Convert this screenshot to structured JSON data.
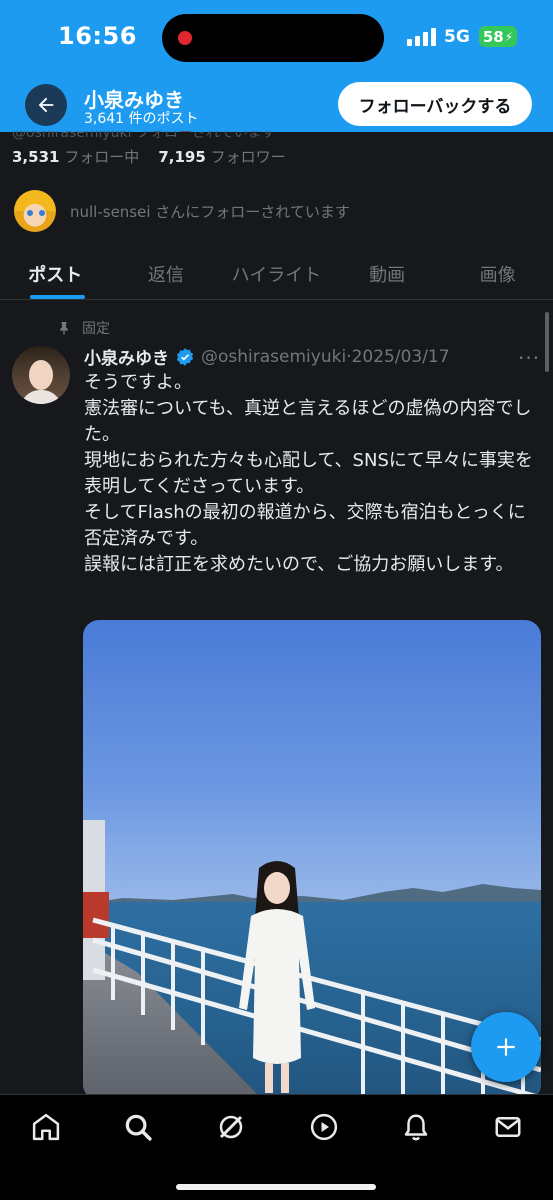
{
  "status_bar": {
    "time": "16:56",
    "network": "5G",
    "battery": "58"
  },
  "header": {
    "name": "小泉みゆき",
    "post_count": "3,641 件のポスト",
    "follow_back_label": "フォローバックする",
    "accent_color": "#1d9bf0"
  },
  "profile": {
    "faded_line": "@oshirasemiyuki  フォローされています",
    "following_count": "3,531",
    "following_label": "フォロー中",
    "followers_count": "7,195",
    "followers_label": "フォロワー",
    "followed_by_user": "null-sensei",
    "followed_by_suffix": " さんにフォローされています"
  },
  "tabs": [
    {
      "label": "ポスト",
      "active": true
    },
    {
      "label": "返信",
      "active": false
    },
    {
      "label": "ハイライト",
      "active": false
    },
    {
      "label": "動画",
      "active": false
    },
    {
      "label": "画像",
      "active": false
    }
  ],
  "post": {
    "pinned_label": "固定",
    "author_name": "小泉みゆき",
    "author_handle": "@oshirasemiyuki",
    "separator": "·",
    "date": "2025/03/17",
    "more": "···",
    "lines": [
      "そうですよ。",
      "憲法審についても、真逆と言えるほどの虚偽の内容でした。",
      "現地におられた方々も心配して、SNSにて早々に事実を表明してくださっています。",
      "そしてFlashの最初の報道から、交際も宿泊もとっくに否定済みです。",
      "誤報には訂正を求めたいので、ご協力お願いします。"
    ]
  },
  "nav": {
    "items": [
      "home-icon",
      "search-icon",
      "grok-icon",
      "video-icon",
      "notifications-icon",
      "messages-icon"
    ]
  }
}
